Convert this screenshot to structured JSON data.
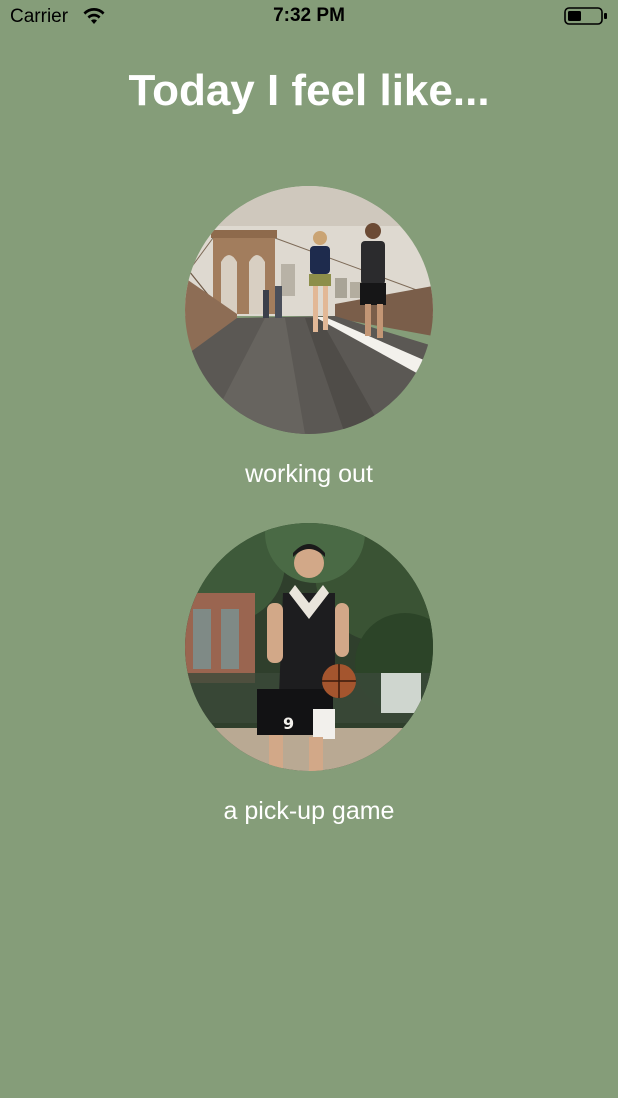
{
  "status_bar": {
    "carrier": "Carrier",
    "time": "7:32 PM",
    "icons": [
      "wifi-icon",
      "battery-icon"
    ]
  },
  "page": {
    "title": "Today I feel like...",
    "background_color": "#859d79"
  },
  "activities": [
    {
      "label": "working out",
      "image": "runners-on-bridge-photo"
    },
    {
      "label": "a pick-up game",
      "image": "basketball-player-photo"
    }
  ]
}
